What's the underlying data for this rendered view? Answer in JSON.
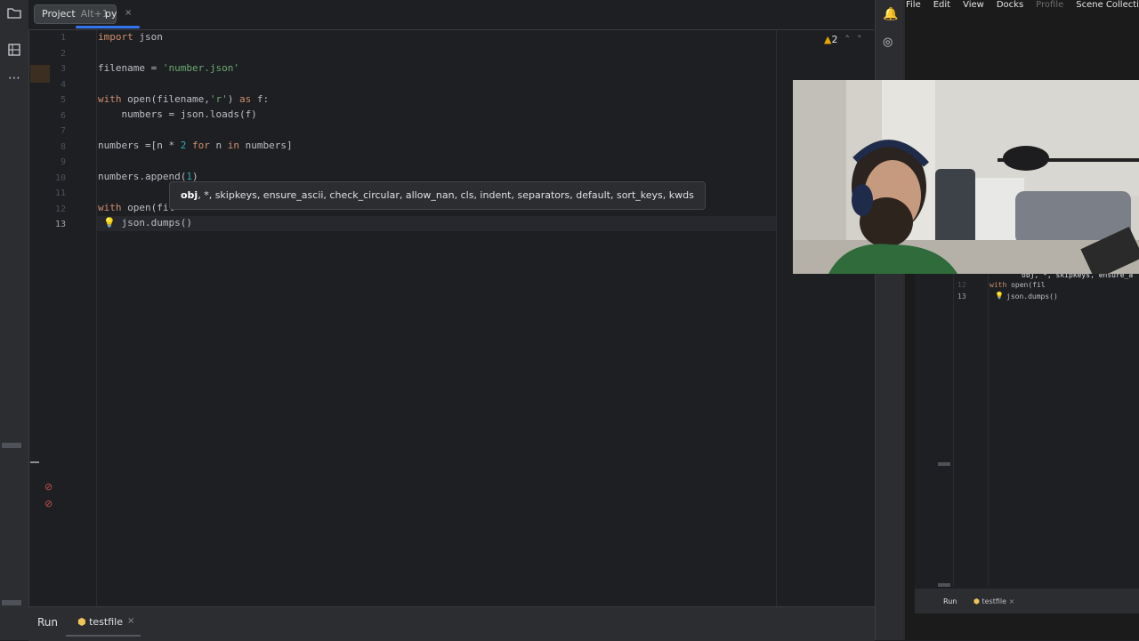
{
  "ide": {
    "tooltip": {
      "label": "Project",
      "shortcut": "Alt+1"
    },
    "tab": {
      "name": "py",
      "close": "×"
    },
    "line_numbers": [
      "1",
      "2",
      "3",
      "4",
      "5",
      "6",
      "7",
      "8",
      "9",
      "10",
      "11",
      "12",
      "13"
    ],
    "code": {
      "l1_kw": "import",
      "l1_rest": " json",
      "l3_a": "filename = ",
      "l3_str": "'number.json'",
      "l5_kw": "with",
      "l5_a": " open(filename,",
      "l5_str": "'r'",
      "l5_b": ") ",
      "l5_kw2": "as",
      "l5_c": " f:",
      "l6": "    numbers = json.loads(f)",
      "l8_a": "numbers =[n * ",
      "l8_num": "2",
      "l8_b": " ",
      "l8_kw": "for",
      "l8_c": " n ",
      "l8_kw2": "in",
      "l8_d": " numbers]",
      "l10_a": "numbers.append(",
      "l10_num": "1",
      "l10_b": ")",
      "l12_kw": "with",
      "l12_a": " open(fil",
      "l13": "    json.dumps()"
    },
    "param_info": {
      "bold": "obj",
      "rest": ", *, skipkeys, ensure_ascii, check_circular, allow_nan, cls, indent, separators, default, sort_keys, kwds"
    },
    "inspection": {
      "count": "2"
    },
    "bottom": {
      "run_label": "Run",
      "config_name": "testfile",
      "close": "×"
    }
  },
  "obs": {
    "menu": [
      "File",
      "Edit",
      "View",
      "Docks",
      "Profile",
      "Scene Collection"
    ],
    "preview": {
      "lines": [
        "12",
        "13"
      ],
      "hint": "obj, *, skipkeys, ensure_a",
      "code12_kw": "with",
      "code12_a": " open(fil",
      "code13": "json.dumps()",
      "run_label": "Run",
      "config_name": "testfile",
      "close": "×"
    }
  },
  "colors": {
    "accent": "#3574f0",
    "keyword": "#cf8e6d",
    "string": "#6aab73",
    "number": "#2aacb8",
    "warning": "#e9a700"
  }
}
